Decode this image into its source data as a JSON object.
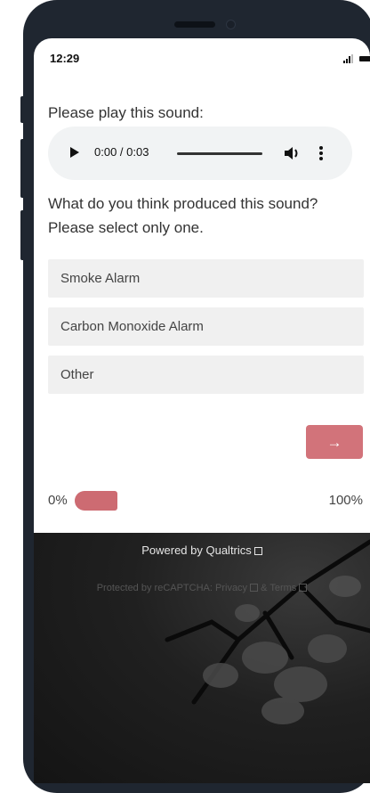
{
  "status_bar": {
    "time": "12:29"
  },
  "survey": {
    "question1": "Please play this sound:",
    "audio": {
      "time_display": "0:00 / 0:03",
      "play_icon": "play-icon",
      "volume_icon": "volume-icon",
      "menu_icon": "more-vertical-icon"
    },
    "question2": "What do you think produced this sound? Please select only one.",
    "choices": [
      {
        "label": "Smoke Alarm"
      },
      {
        "label": "Carbon Monoxide Alarm"
      },
      {
        "label": "Other"
      }
    ],
    "next_label": "→",
    "progress": {
      "start_label": "0%",
      "end_label": "100%",
      "fraction": 0.1
    }
  },
  "footer": {
    "powered_by": "Powered by Qualtrics",
    "recaptcha_prefix": "Protected by reCAPTCHA:",
    "privacy_label": "Privacy",
    "ampersand": "&",
    "terms_label": "Terms"
  },
  "colors": {
    "accent": "#d2737a",
    "phone_frame": "#1f2630",
    "footer_bg": "#1a1a1a",
    "choice_bg": "#f0f0f0"
  }
}
